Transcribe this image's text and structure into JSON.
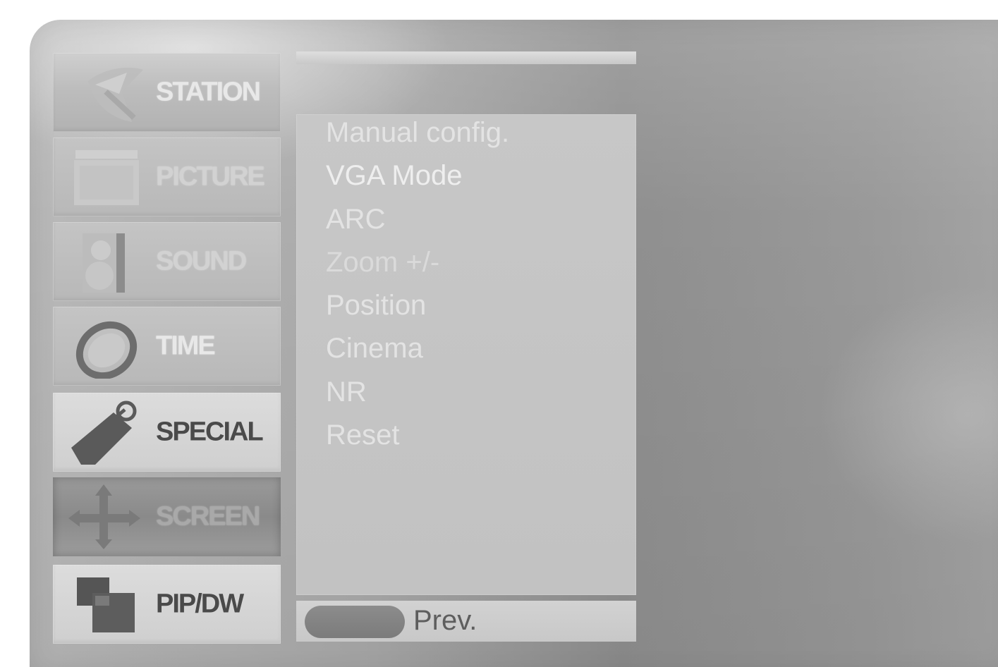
{
  "menu": {
    "items": [
      {
        "label": "STATION",
        "icon": "satellite-dish-icon",
        "state": "normal"
      },
      {
        "label": "PICTURE",
        "icon": "tv-screen-icon",
        "state": "faint"
      },
      {
        "label": "SOUND",
        "icon": "speaker-icon",
        "state": "faint"
      },
      {
        "label": "TIME",
        "icon": "clock-ring-icon",
        "state": "normal"
      },
      {
        "label": "SPECIAL",
        "icon": "tag-icon",
        "state": "bright"
      },
      {
        "label": "SCREEN",
        "icon": "move-arrows-icon",
        "state": "selected"
      },
      {
        "label": "PIP/DW",
        "icon": "pip-windows-icon",
        "state": "bright"
      }
    ]
  },
  "submenu": {
    "title": "",
    "items": [
      "Manual config.",
      "VGA Mode",
      "ARC",
      "Zoom +/-",
      "Position",
      "Cinema",
      "NR",
      "Reset"
    ]
  },
  "footer": {
    "prev_label": "Prev.",
    "key_icon": "menu-key-icon"
  },
  "colors": {
    "panel": "#a8a8a8",
    "menu_item": "#c2c2c2",
    "selected_item": "#8f8f8f",
    "text_light": "#e3e3e3",
    "text_dark": "#4a4a4a"
  }
}
